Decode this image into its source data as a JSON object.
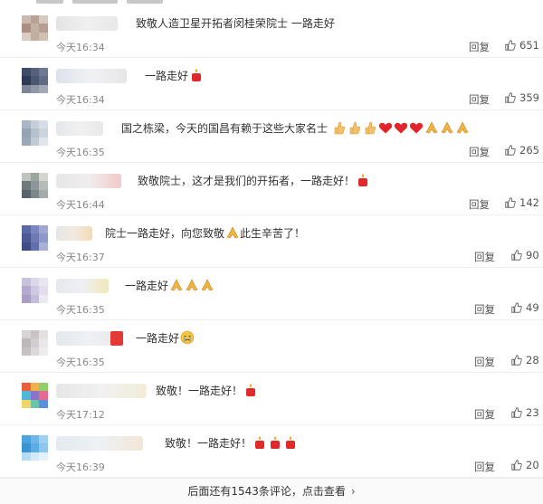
{
  "comments": [
    {
      "text": "致敬人造卫星开拓者闵桂荣院士 一路走好",
      "time": "今天16:34",
      "reply": "回复",
      "likes": "651",
      "emojis": []
    },
    {
      "text": "一路走好",
      "time": "今天16:34",
      "reply": "回复",
      "likes": "359",
      "emojis": [
        "candle"
      ]
    },
    {
      "text": "国之栋梁，今天的国昌有赖于这些大家名士",
      "time": "今天16:35",
      "reply": "回复",
      "likes": "265",
      "emojis": [
        "thumb",
        "thumb",
        "thumb",
        "heart",
        "heart",
        "heart",
        "pray",
        "pray",
        "pray"
      ]
    },
    {
      "text": "致敬院士，这才是我们的开拓者，一路走好！",
      "time": "今天16:44",
      "reply": "回复",
      "likes": "142",
      "emojis": [
        "candle"
      ]
    },
    {
      "text": "院士一路走好，向您致敬",
      "text2": "此生辛苦了！",
      "time": "今天16:37",
      "reply": "回复",
      "likes": "90",
      "emojis": []
    },
    {
      "text": "一路走好",
      "time": "今天16:35",
      "reply": "回复",
      "likes": "49",
      "emojis": [
        "pray",
        "pray",
        "pray"
      ]
    },
    {
      "text": "一路走好",
      "time": "今天16:35",
      "reply": "回复",
      "likes": "28",
      "emojis": [
        "cry"
      ]
    },
    {
      "text": "致敬！一路走好！",
      "time": "今天17:12",
      "reply": "回复",
      "likes": "23",
      "emojis": [
        "candle"
      ]
    },
    {
      "text": "致敬！一路走好！",
      "time": "今天16:39",
      "reply": "回复",
      "likes": "20",
      "emojis": [
        "candle",
        "candle",
        "candle"
      ]
    }
  ],
  "footer": {
    "label": "后面还有1543条评论，点击查看"
  },
  "icons": {
    "like": "thumbs-up-icon",
    "more": "chevron-right-icon",
    "candle": "candle-emoji",
    "pray": "pray-emoji",
    "heart": "heart-emoji",
    "thumb": "thumb-emoji",
    "cry": "cry-emoji"
  }
}
